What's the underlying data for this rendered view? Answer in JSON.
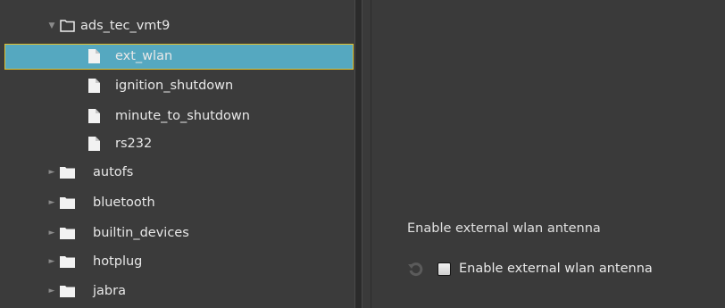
{
  "tree": {
    "items": [
      {
        "label": "ads_tec_vmt9",
        "type": "folder-open",
        "expanded": true
      },
      {
        "label": "ext_wlan",
        "type": "file",
        "selected": true
      },
      {
        "label": "ignition_shutdown",
        "type": "file"
      },
      {
        "label": "minute_to_shutdown",
        "type": "file"
      },
      {
        "label": "rs232",
        "type": "file"
      },
      {
        "label": "autofs",
        "type": "folder",
        "expanded": false
      },
      {
        "label": "bluetooth",
        "type": "folder",
        "expanded": false
      },
      {
        "label": "builtin_devices",
        "type": "folder",
        "expanded": false
      },
      {
        "label": "hotplug",
        "type": "folder",
        "expanded": false
      },
      {
        "label": "jabra",
        "type": "folder",
        "expanded": false
      }
    ]
  },
  "settings": {
    "section_title": "Enable external wlan antenna",
    "checkbox_label": "Enable external wlan antenna",
    "checked": false
  },
  "colors": {
    "selection": "#55a8c0",
    "selection_border": "#e3c12b",
    "background": "#3a3a3a"
  }
}
